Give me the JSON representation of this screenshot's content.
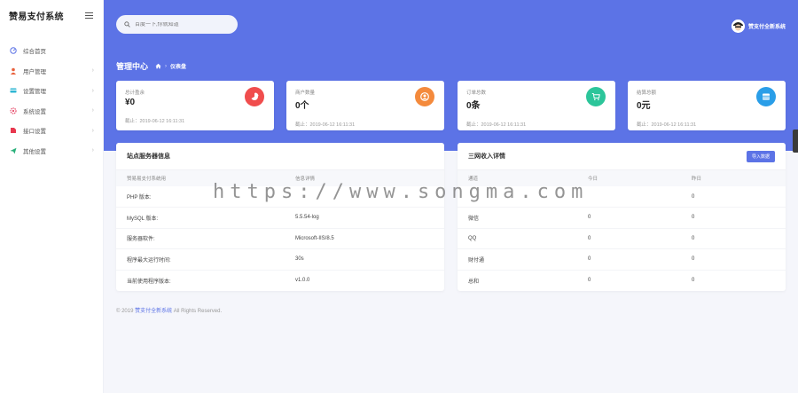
{
  "app": {
    "brand": "赞易支付系统"
  },
  "sidebar": {
    "items": [
      {
        "label": "综合首页",
        "icon": "dashboard-icon",
        "color": "#5c73e6",
        "has_arrow": false
      },
      {
        "label": "用户管理",
        "icon": "user-icon",
        "color": "#e8603c",
        "has_arrow": true
      },
      {
        "label": "设置管理",
        "icon": "card-icon",
        "color": "#2eb6d3",
        "has_arrow": true
      },
      {
        "label": "系统设置",
        "icon": "gear-icon",
        "color": "#e64a6a",
        "has_arrow": true
      },
      {
        "label": "接口设置",
        "icon": "plug-icon",
        "color": "#e8384f",
        "has_arrow": true
      },
      {
        "label": "其他设置",
        "icon": "send-icon",
        "color": "#29b07a",
        "has_arrow": true
      }
    ]
  },
  "header": {
    "search_placeholder": "百度一下,你就知道",
    "user_name": "赞支付全新系统",
    "page_title": "管理中心",
    "breadcrumb": "仪表盘"
  },
  "stats": [
    {
      "label": "总计盈余",
      "value": "¥0",
      "time": "截止：2019-06-12 16:11:31",
      "icon": "pie-chart-icon",
      "color": "#f04d4d"
    },
    {
      "label": "商户数量",
      "value": "0个",
      "time": "截止：2019-06-12 16:11:31",
      "icon": "user-circle-icon",
      "color": "#f48a3c"
    },
    {
      "label": "订单总数",
      "value": "0条",
      "time": "截止：2019-06-12 16:11:31",
      "icon": "cart-icon",
      "color": "#2cc59a"
    },
    {
      "label": "结算总额",
      "value": "0元",
      "time": "截止：2019-06-12 16:11:31",
      "icon": "wallet-icon",
      "color": "#2a9ee8"
    }
  ],
  "server_panel": {
    "title": "站点服务器信息",
    "columns": [
      "赞易易支付系统用",
      "信息详情"
    ],
    "rows": [
      [
        "PHP 版本:",
        ""
      ],
      [
        "MySQL 版本:",
        "5.5.54-log"
      ],
      [
        "服务器软件:",
        "Microsoft-IIS/8.5"
      ],
      [
        "程序最大运行时间:",
        "30s"
      ],
      [
        "当前使用程序版本:",
        "v1.0.0"
      ]
    ]
  },
  "income_panel": {
    "title": "三网收入详情",
    "export_label": "导入数据",
    "columns": [
      "通道",
      "今日",
      "昨日"
    ],
    "rows": [
      [
        "",
        "",
        "0"
      ],
      [
        "微信",
        "0",
        "0"
      ],
      [
        "QQ",
        "0",
        "0"
      ],
      [
        "财付通",
        "0",
        "0"
      ],
      [
        "总和",
        "0",
        "0"
      ]
    ]
  },
  "footer": {
    "prefix": "© 2019",
    "link": "赞支付全新系统",
    "suffix": "All Rights Reserved."
  },
  "watermark": "https://www.songma.com",
  "colors": {
    "primary": "#5c73e6",
    "background": "#f5f6fb"
  }
}
